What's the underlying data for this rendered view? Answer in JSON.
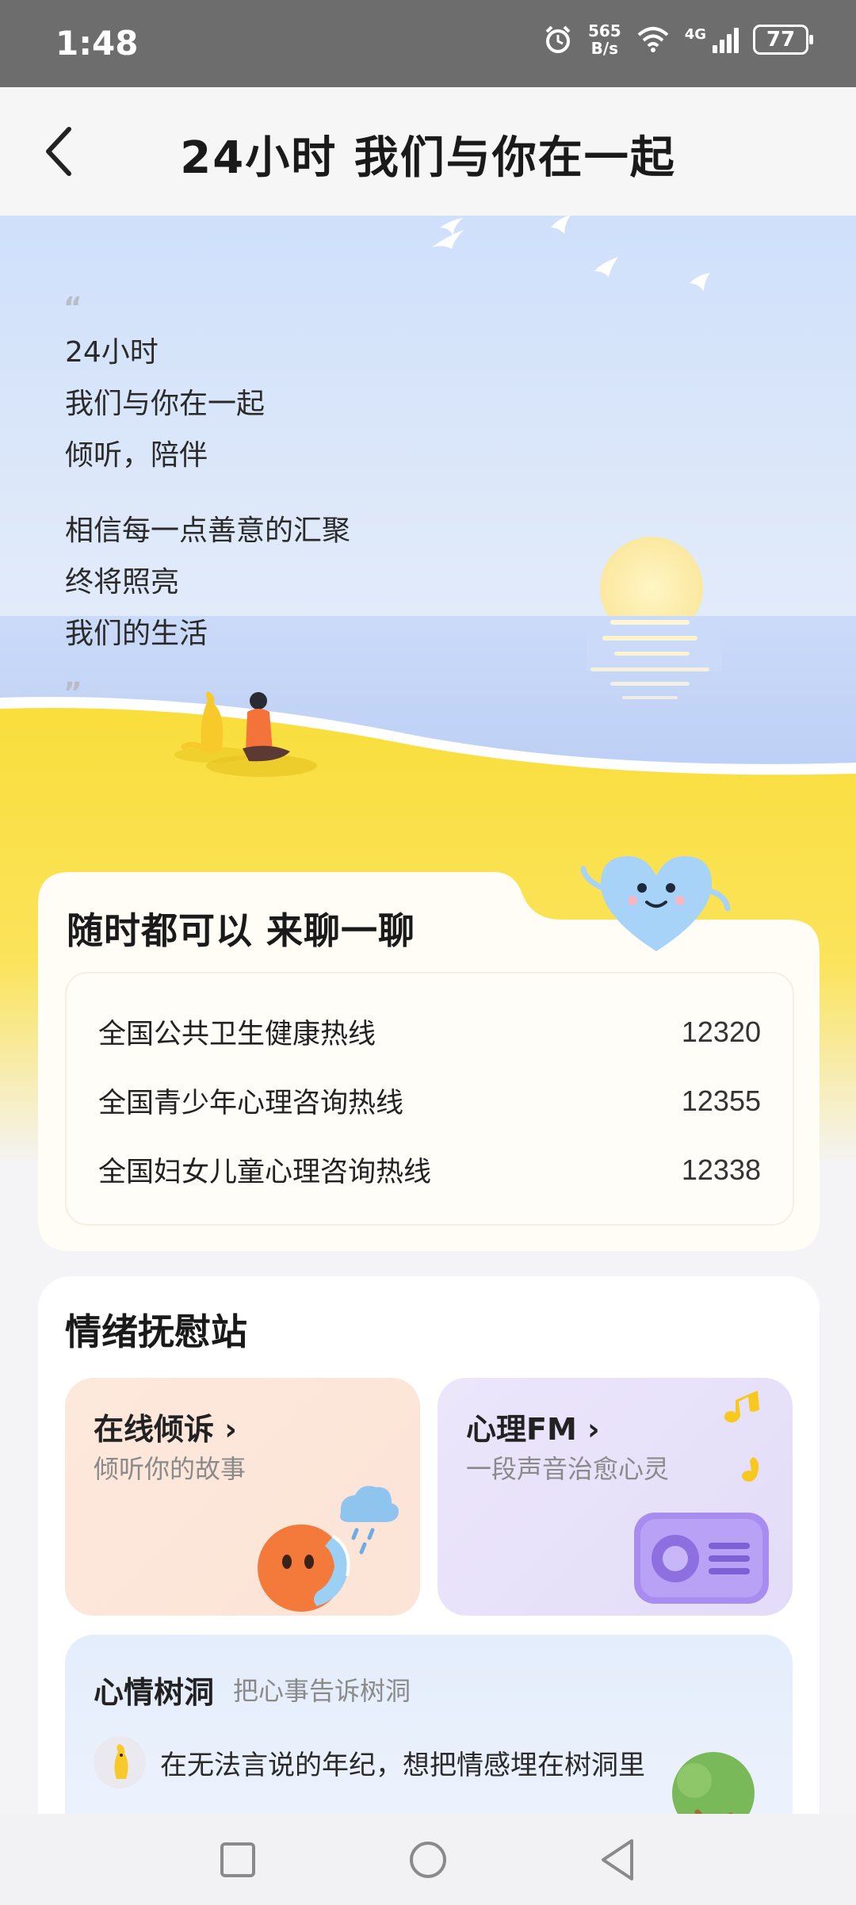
{
  "status_bar": {
    "time": "1:48",
    "speed_value": "565",
    "speed_unit": "B/s",
    "network": "4G",
    "battery": "77"
  },
  "header": {
    "title": "24小时 我们与你在一起"
  },
  "hero": {
    "quote_open": "“",
    "quote_close": "”",
    "lines_group1": [
      "24小时",
      "我们与你在一起",
      "倾听，陪伴"
    ],
    "lines_group2": [
      "相信每一点善意的汇聚",
      "终将照亮",
      "我们的生活"
    ]
  },
  "hotline": {
    "title": "随时都可以 来聊一聊",
    "items": [
      {
        "name": "全国公共卫生健康热线",
        "number": "12320"
      },
      {
        "name": "全国青少年心理咨询热线",
        "number": "12355"
      },
      {
        "name": "全国妇女儿童心理咨询热线",
        "number": "12338"
      }
    ]
  },
  "comfort": {
    "title": "情绪抚慰站",
    "online": {
      "name": "在线倾诉",
      "chevron": "›",
      "sub": "倾听你的故事"
    },
    "fm": {
      "name": "心理FM",
      "chevron": "›",
      "sub": "一段声音治愈心灵"
    },
    "tree_hole": {
      "title": "心情树洞",
      "sub": "把心事告诉树洞",
      "post": "在无法言说的年纪，想把情感埋在树洞里"
    }
  },
  "colors": {
    "sand": "#f7dc3d",
    "sky": "#cfe0fb",
    "accent_orange": "#f4733b",
    "fm_purple": "#a98cf0"
  }
}
